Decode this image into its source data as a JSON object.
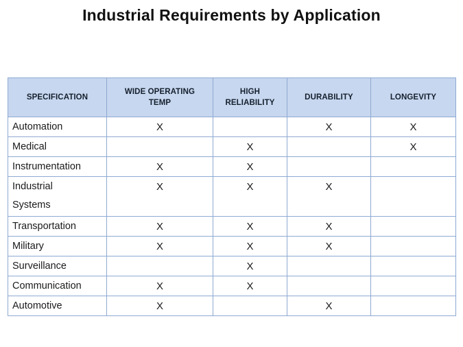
{
  "document": {
    "title": "Industrial Requirements by Application",
    "background_color": "#ffffff",
    "title_color": "#111111"
  },
  "table": {
    "header_background": "#c7d7ef",
    "border_color": "#8ea9d2",
    "mark_symbol": "X",
    "columns": [
      {
        "id": "specification",
        "label": "SPECIFICATION",
        "line1": "SPECIFICATION",
        "line2": ""
      },
      {
        "id": "wide_operating_temp",
        "label": "WIDE OPERATING TEMP",
        "line1": "WIDE OPERATING",
        "line2": "TEMP"
      },
      {
        "id": "high_reliability",
        "label": "HIGH RELIABILITY",
        "line1": "HIGH",
        "line2": "RELIABILITY"
      },
      {
        "id": "durability",
        "label": "DURABILITY",
        "line1": "DURABILITY",
        "line2": ""
      },
      {
        "id": "longevity",
        "label": "LONGEVITY",
        "line1": "LONGEVITY",
        "line2": ""
      }
    ],
    "rows": [
      {
        "label": "Automation",
        "label_line1": "Automation",
        "label_line2": "",
        "tall": false,
        "wide_operating_temp": "X",
        "high_reliability": "",
        "durability": "X",
        "longevity": "X"
      },
      {
        "label": "Medical",
        "label_line1": "Medical",
        "label_line2": "",
        "tall": false,
        "wide_operating_temp": "",
        "high_reliability": "X",
        "durability": "",
        "longevity": "X"
      },
      {
        "label": "Instrumentation",
        "label_line1": "Instrumentation",
        "label_line2": "",
        "tall": false,
        "wide_operating_temp": "X",
        "high_reliability": "X",
        "durability": "",
        "longevity": ""
      },
      {
        "label": "Industrial Systems",
        "label_line1": "Industrial",
        "label_line2": "Systems",
        "tall": true,
        "wide_operating_temp": "X",
        "high_reliability": "X",
        "durability": "X",
        "longevity": ""
      },
      {
        "label": "Transportation",
        "label_line1": "Transportation",
        "label_line2": "",
        "tall": false,
        "wide_operating_temp": "X",
        "high_reliability": "X",
        "durability": "X",
        "longevity": ""
      },
      {
        "label": "Military",
        "label_line1": "Military",
        "label_line2": "",
        "tall": false,
        "wide_operating_temp": "X",
        "high_reliability": "X",
        "durability": "X",
        "longevity": ""
      },
      {
        "label": "Surveillance",
        "label_line1": "Surveillance",
        "label_line2": "",
        "tall": false,
        "wide_operating_temp": "",
        "high_reliability": "X",
        "durability": "",
        "longevity": ""
      },
      {
        "label": "Communication",
        "label_line1": "Communication",
        "label_line2": "",
        "tall": false,
        "wide_operating_temp": "X",
        "high_reliability": "X",
        "durability": "",
        "longevity": ""
      },
      {
        "label": "Automotive",
        "label_line1": "Automotive",
        "label_line2": "",
        "tall": false,
        "wide_operating_temp": "X",
        "high_reliability": "",
        "durability": "X",
        "longevity": ""
      }
    ]
  }
}
